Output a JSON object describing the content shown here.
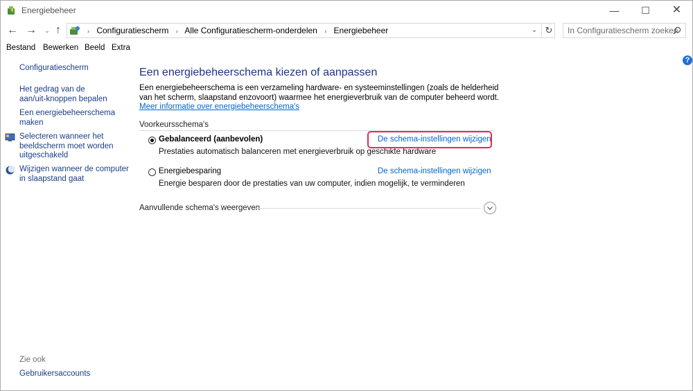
{
  "window": {
    "title": "Energiebeheer"
  },
  "window_controls": {
    "minimize": "—",
    "maximize": "☐",
    "close": "✕"
  },
  "nav": {
    "back": "←",
    "forward": "→",
    "recent": "⌄",
    "up": "↑"
  },
  "address": {
    "crumbs": [
      "Configuratiescherm",
      "Alle Configuratiescherm-onderdelen",
      "Energiebeheer"
    ],
    "separator": "›",
    "dropdown": "⌄",
    "refresh": "↻"
  },
  "search": {
    "placeholder": "In Configuratiescherm zoeken"
  },
  "menu": [
    "Bestand",
    "Bewerken",
    "Beeld",
    "Extra"
  ],
  "help": "?",
  "sidebar": {
    "home": "Configuratiescherm",
    "links": [
      {
        "line1": "Het gedrag van de",
        "line2": "aan/uit-knoppen bepalen",
        "icon": "none"
      },
      {
        "line1": "Een energiebeheerschema",
        "line2": "maken",
        "icon": "none"
      },
      {
        "line1": "Selecteren wanneer het",
        "line2": "beeldscherm moet worden",
        "line3": "uitgeschakeld",
        "icon": "monitor-icon"
      },
      {
        "line1": "Wijzigen wanneer de computer",
        "line2": "in slaapstand gaat",
        "icon": "moon-icon"
      }
    ],
    "see_also": "Zie ook",
    "user_accounts": "Gebruikersaccounts"
  },
  "main": {
    "heading": "Een energiebeheerschema kiezen of aanpassen",
    "intro_text": "Een energiebeheerschema is een verzameling hardware- en systeeminstellingen (zoals de helderheid van het scherm, slaapstand enzovoort) waarmee het energieverbruik van de computer beheerd wordt. ",
    "intro_link": "Meer informatie over energiebeheerschema's",
    "group_label": "Voorkeursschema's",
    "plans": [
      {
        "name": "Gebalanceerd (aanbevolen)",
        "selected": true,
        "description": "Prestaties automatisch balanceren met energieverbruik op geschikte hardware",
        "link": "De schema-instellingen wijzigen"
      },
      {
        "name": "Energiebesparing",
        "selected": false,
        "description": "Energie besparen door de prestaties van uw computer, indien mogelijk, te verminderen",
        "link": "De schema-instellingen wijzigen"
      }
    ],
    "more_plans": "Aanvullende schema's weergeven",
    "expand": "⌄"
  },
  "colors": {
    "link": "#0066cc",
    "heading": "#1e3287",
    "highlight": "#e02c5c"
  }
}
